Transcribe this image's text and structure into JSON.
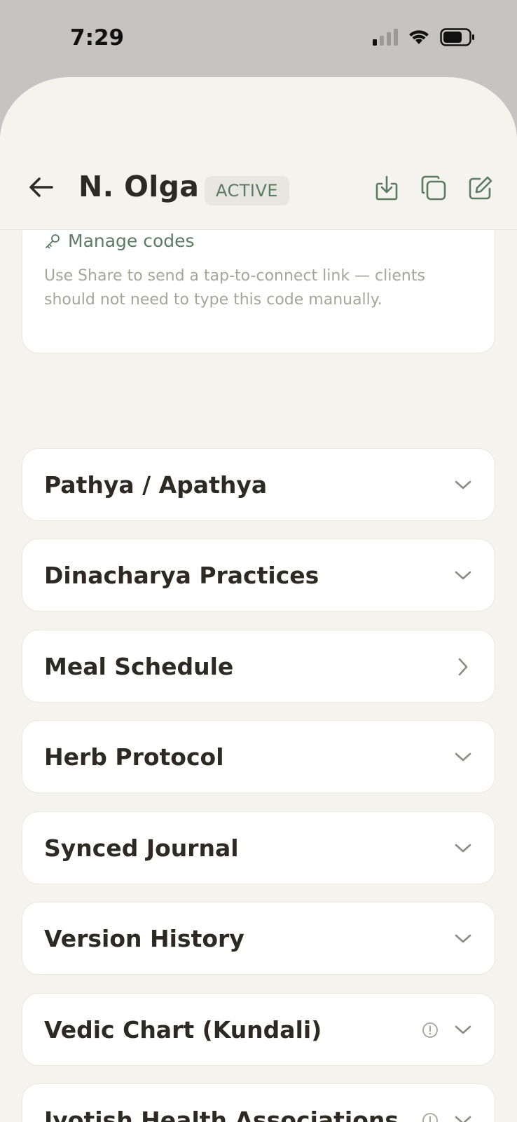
{
  "status_bar": {
    "time": "7:29"
  },
  "header": {
    "title": "N. Olga",
    "badge": "ACTIVE"
  },
  "codes_card": {
    "link_label": "Manage codes",
    "note": "Use Share to send a tap-to-connect link — clients should not need to type this code manually."
  },
  "sections": [
    {
      "label": "Pathya / Apathya",
      "indicator": "chevron-down-icon"
    },
    {
      "label": "Dinacharya Practices",
      "indicator": "chevron-down-icon"
    },
    {
      "label": "Meal Schedule",
      "indicator": "chevron-right-icon"
    },
    {
      "label": "Herb Protocol",
      "indicator": "chevron-down-icon"
    },
    {
      "label": "Synced Journal",
      "indicator": "chevron-down-icon"
    },
    {
      "label": "Version History",
      "indicator": "chevron-down-icon"
    },
    {
      "label": "Vedic Chart (Kundali)",
      "indicator": "chevron-down-icon",
      "info": true
    },
    {
      "label": "Jyotish Health Associations",
      "indicator": "chevron-down-icon",
      "info": true
    }
  ],
  "colors": {
    "accent_green": "#5b7b63",
    "background": "#f5f3ee",
    "card": "#ffffff",
    "text": "#2c2a22",
    "muted": "#a7a49c"
  }
}
